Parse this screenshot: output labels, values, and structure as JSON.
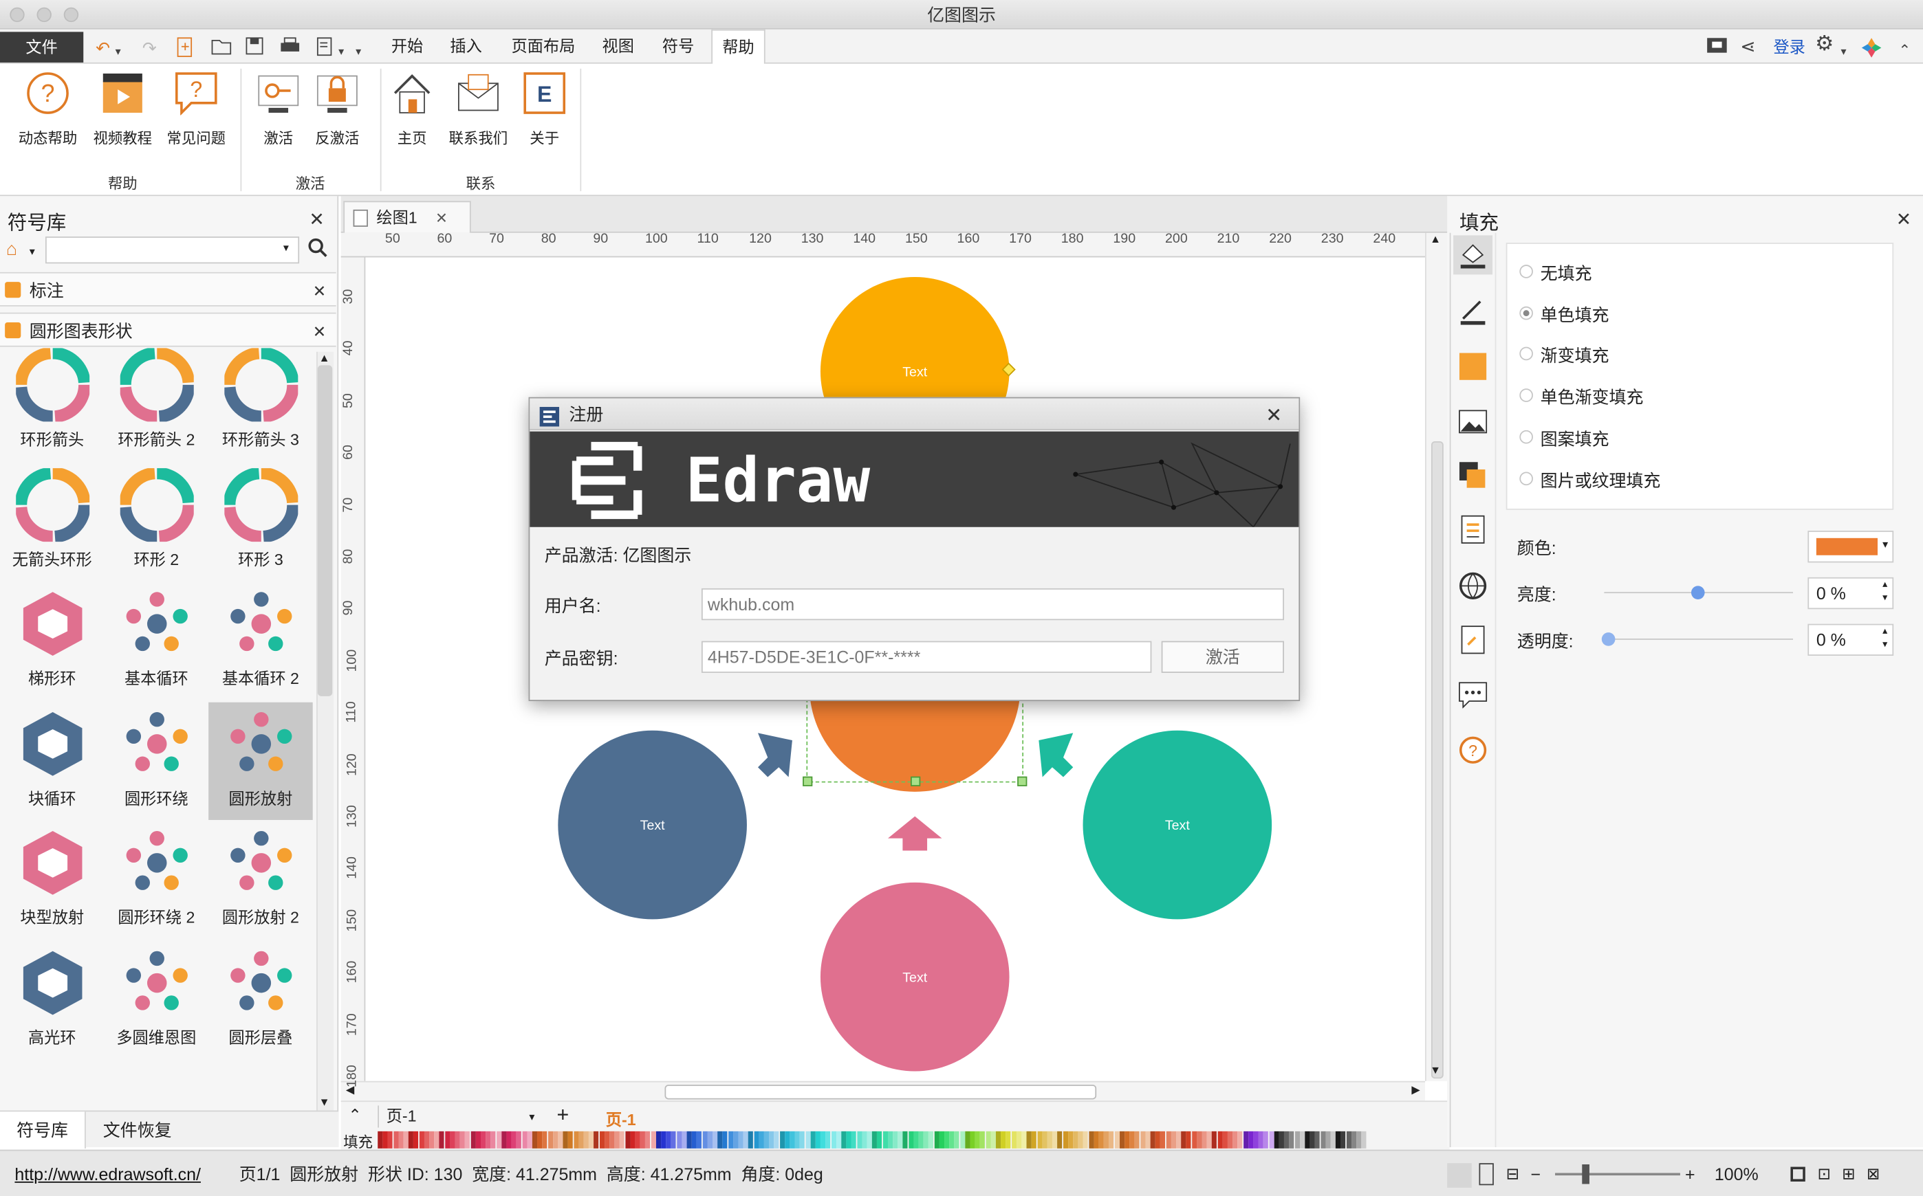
{
  "window": {
    "title": "亿图图示"
  },
  "menu": {
    "file": "文件",
    "tabs": [
      "开始",
      "插入",
      "页面布局",
      "视图",
      "符号",
      "帮助"
    ],
    "active_tab": "帮助",
    "login": "登录"
  },
  "ribbon": {
    "buttons": [
      {
        "label": "动态帮助",
        "icon": "question-bubble-icon"
      },
      {
        "label": "视频教程",
        "icon": "video-clapper-icon"
      },
      {
        "label": "常见问题",
        "icon": "faq-bubble-icon"
      },
      {
        "label": "激活",
        "icon": "key-icon"
      },
      {
        "label": "反激活",
        "icon": "lock-icon"
      },
      {
        "label": "主页",
        "icon": "home-icon"
      },
      {
        "label": "联系我们",
        "icon": "envelope-icon"
      },
      {
        "label": "关于",
        "icon": "edraw-logo-icon"
      }
    ],
    "groups": [
      "帮助",
      "激活",
      "联系"
    ]
  },
  "library": {
    "title": "符号库",
    "search_placeholder": "",
    "sections": [
      "标注",
      "圆形图表形状"
    ],
    "shapes": [
      "环形箭头",
      "环形箭头 2",
      "环形箭头 3",
      "无箭头环形",
      "环形 2",
      "环形 3",
      "梯形环",
      "基本循环",
      "基本循环 2",
      "块循环",
      "圆形环绕",
      "圆形放射",
      "块型放射",
      "圆形环绕 2",
      "圆形放射 2",
      "高光环",
      "多圆维恩图",
      "圆形层叠"
    ],
    "selected": "圆形放射",
    "bottom_tabs": [
      "符号库",
      "文件恢复"
    ]
  },
  "document": {
    "tab": "绘图1",
    "page_selector": "页-1",
    "page_tab": "页-1",
    "fill_label": "填充"
  },
  "rulers": {
    "h": [
      "50",
      "60",
      "70",
      "80",
      "90",
      "100",
      "110",
      "120",
      "130",
      "140",
      "150",
      "160",
      "170",
      "180",
      "190",
      "200",
      "210",
      "220",
      "230",
      "240"
    ],
    "v": [
      "30",
      "40",
      "50",
      "60",
      "70",
      "80",
      "90",
      "100",
      "110",
      "120",
      "130",
      "140",
      "150",
      "160",
      "170",
      "180"
    ]
  },
  "diagram": {
    "labels": [
      "Text",
      "Text",
      "Text",
      "Text"
    ],
    "colors": {
      "orange_top": "#fbab00",
      "orange_center": "#ed7d31",
      "blue": "#4e6e91",
      "teal": "#1dbb9d",
      "pink": "#e0708f"
    }
  },
  "fill_panel": {
    "title": "填充",
    "options": [
      "无填充",
      "单色填充",
      "渐变填充",
      "单色渐变填充",
      "图案填充",
      "图片或纹理填充"
    ],
    "selected": "单色填充",
    "color_label": "颜色:",
    "color_value": "#ed7d31",
    "brightness_label": "亮度:",
    "brightness_value": "0 %",
    "brightness_level": 0.5,
    "transparency_label": "透明度:",
    "transparency_value": "0 %",
    "transparency_level": 0
  },
  "dialog": {
    "title": "注册",
    "brand": "Edraw",
    "product_line": "产品激活: 亿图图示",
    "username_label": "用户名:",
    "username_value": "wkhub.com",
    "key_label": "产品密钥:",
    "key_value": "4H57-D5DE-3E1C-0F**-****",
    "activate_button": "激活"
  },
  "status": {
    "url": "http://www.edrawsoft.cn/",
    "info": "页1/1  圆形放射  形状 ID: 130  宽度: 41.275mm  高度: 41.275mm  角度: 0deg",
    "zoom": "100%"
  }
}
